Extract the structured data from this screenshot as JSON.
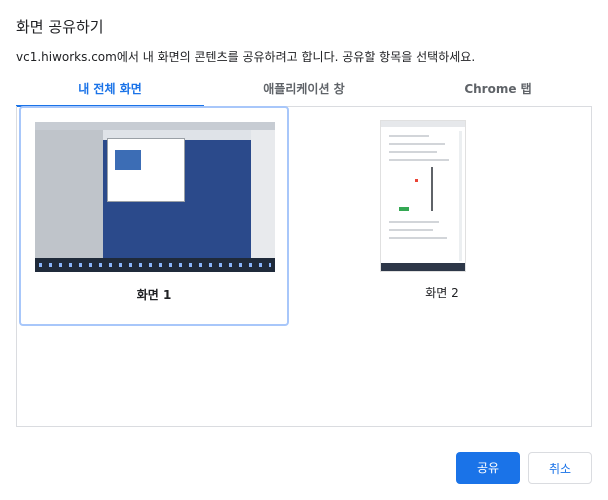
{
  "dialog": {
    "title": "화면 공유하기",
    "description": "vc1.hiworks.com에서 내 화면의 콘텐츠를 공유하려고 합니다. 공유할 항목을 선택하세요."
  },
  "tabs": [
    {
      "label": "내 전체 화면",
      "active": true
    },
    {
      "label": "애플리케이션 창",
      "active": false
    },
    {
      "label": "Chrome 탭",
      "active": false
    }
  ],
  "screens": [
    {
      "label": "화면 1",
      "selected": true
    },
    {
      "label": "화면 2",
      "selected": false
    }
  ],
  "buttons": {
    "share": "공유",
    "cancel": "취소"
  },
  "colors": {
    "accent": "#1a73e8",
    "selected_border": "#a8c7fa"
  }
}
